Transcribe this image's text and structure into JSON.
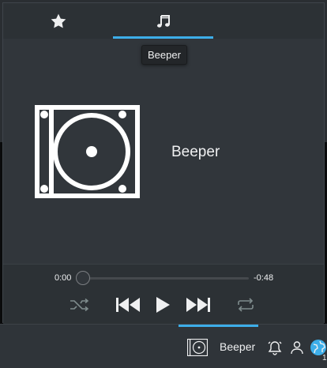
{
  "tabs": [
    {
      "id": "favorites",
      "icon": "star-icon"
    },
    {
      "id": "media",
      "icon": "music-note-icon",
      "active": true
    }
  ],
  "tooltip": {
    "text": "Beeper"
  },
  "player": {
    "track_title": "Beeper",
    "album_art_icon": "media-player-icon",
    "position_label": "0:00",
    "remaining_label": "-0:48",
    "progress": 0
  },
  "controls": {
    "shuffle_icon": "shuffle-icon",
    "previous_icon": "skip-previous-icon",
    "play_icon": "play-icon",
    "next_icon": "skip-next-icon",
    "repeat_icon": "repeat-icon"
  },
  "panel": {
    "media_label": "Beeper",
    "tray_icons": [
      "notifications-bell-icon",
      "user-icon",
      "network-globe-icon"
    ],
    "clock_fragment": "1"
  },
  "colors": {
    "accent": "#3daee9",
    "popup_bg": "#31363b",
    "panel_bg": "#2f3439",
    "text": "#eff0f1"
  }
}
